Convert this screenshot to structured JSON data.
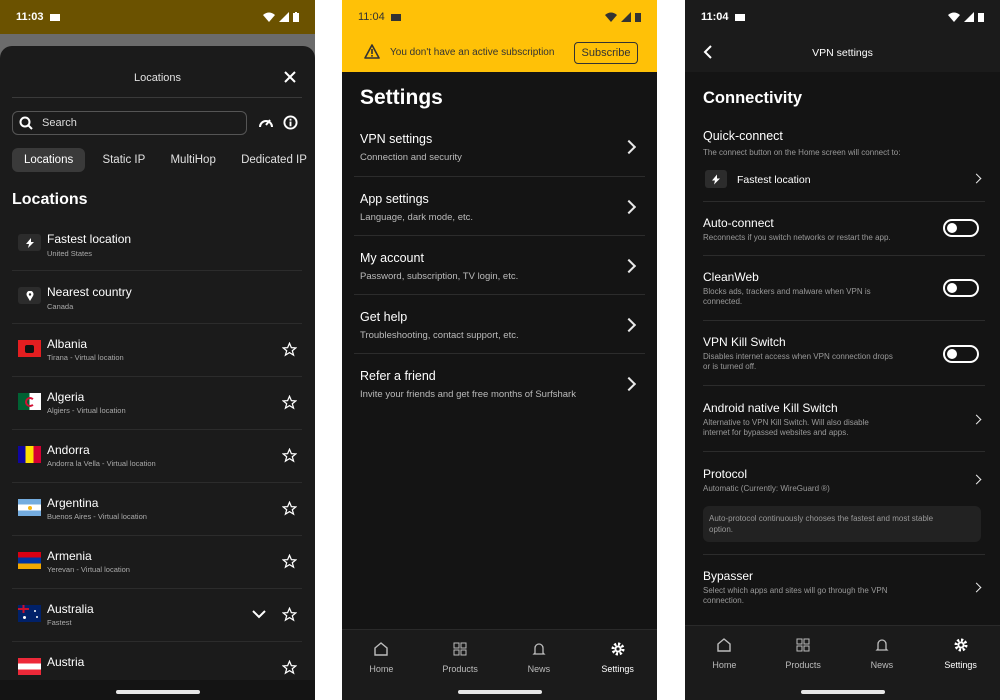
{
  "colors": {
    "accent": "#ffc107",
    "dark_bg": "#141414",
    "sheet_bg": "#1b1b1b"
  },
  "screen1": {
    "status_time": "11:03",
    "title": "Locations",
    "search_placeholder": "Search",
    "tabs": [
      "Locations",
      "Static IP",
      "MultiHop",
      "Dedicated IP"
    ],
    "section_heading": "Locations",
    "items": [
      {
        "name": "Fastest location",
        "sub": "United States",
        "icon": "bolt-icon"
      },
      {
        "name": "Nearest country",
        "sub": "Canada",
        "icon": "pin-icon"
      },
      {
        "name": "Albania",
        "sub": "Tirana - Virtual location",
        "flag": "albania-flag"
      },
      {
        "name": "Algeria",
        "sub": "Algiers - Virtual location",
        "flag": "algeria-flag"
      },
      {
        "name": "Andorra",
        "sub": "Andorra la Vella - Virtual location",
        "flag": "andorra-flag"
      },
      {
        "name": "Argentina",
        "sub": "Buenos Aires - Virtual location",
        "flag": "argentina-flag"
      },
      {
        "name": "Armenia",
        "sub": "Yerevan - Virtual location",
        "flag": "armenia-flag"
      },
      {
        "name": "Australia",
        "sub": "Fastest",
        "flag": "australia-flag"
      },
      {
        "name": "Austria",
        "sub": "",
        "flag": "austria-flag"
      }
    ]
  },
  "screen2": {
    "status_time": "11:04",
    "banner_text": "You don't have an active subscription",
    "subscribe_label": "Subscribe",
    "title": "Settings",
    "items": [
      {
        "title": "VPN settings",
        "sub": "Connection and security"
      },
      {
        "title": "App settings",
        "sub": "Language, dark mode, etc."
      },
      {
        "title": "My account",
        "sub": "Password, subscription, TV login, etc."
      },
      {
        "title": "Get help",
        "sub": "Troubleshooting, contact support, etc."
      },
      {
        "title": "Refer a friend",
        "sub": "Invite your friends and get free months of Surfshark"
      }
    ]
  },
  "screen3": {
    "status_time": "11:04",
    "header_title": "VPN settings",
    "section_heading": "Connectivity",
    "quick_connect": {
      "title": "Quick-connect",
      "sub": "The connect button on the Home screen will connect to:",
      "value": "Fastest location"
    },
    "auto_connect": {
      "title": "Auto-connect",
      "sub": "Reconnects if you switch networks or restart the app."
    },
    "cleanweb": {
      "title": "CleanWeb",
      "sub1": "Blocks ads, trackers and malware when VPN is",
      "sub2": "connected."
    },
    "kill_switch": {
      "title": "VPN Kill Switch",
      "sub1": "Disables internet access when VPN connection drops",
      "sub2": "or is turned off."
    },
    "native_kill": {
      "title": "Android native Kill Switch",
      "sub1": "Alternative to VPN Kill Switch. Will also disable",
      "sub2": "internet for bypassed websites and apps."
    },
    "protocol": {
      "title": "Protocol",
      "sub": "Automatic (Currently: WireGuard ®)",
      "note1": "Auto-protocol continuously chooses the fastest and most stable",
      "note2": "option."
    },
    "bypasser": {
      "title": "Bypasser",
      "sub1": "Select which apps and sites will go through the VPN",
      "sub2": "connection."
    }
  },
  "nav": [
    "Home",
    "Products",
    "News",
    "Settings"
  ]
}
